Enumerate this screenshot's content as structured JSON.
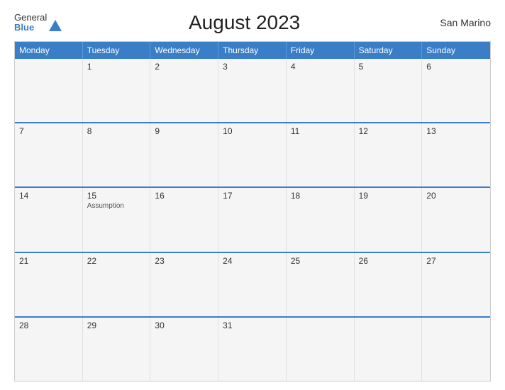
{
  "header": {
    "logo_general": "General",
    "logo_blue": "Blue",
    "title": "August 2023",
    "country": "San Marino"
  },
  "calendar": {
    "days_of_week": [
      "Monday",
      "Tuesday",
      "Wednesday",
      "Thursday",
      "Friday",
      "Saturday",
      "Sunday"
    ],
    "weeks": [
      [
        {
          "day": "",
          "event": ""
        },
        {
          "day": "1",
          "event": ""
        },
        {
          "day": "2",
          "event": ""
        },
        {
          "day": "3",
          "event": ""
        },
        {
          "day": "4",
          "event": ""
        },
        {
          "day": "5",
          "event": ""
        },
        {
          "day": "6",
          "event": ""
        }
      ],
      [
        {
          "day": "7",
          "event": ""
        },
        {
          "day": "8",
          "event": ""
        },
        {
          "day": "9",
          "event": ""
        },
        {
          "day": "10",
          "event": ""
        },
        {
          "day": "11",
          "event": ""
        },
        {
          "day": "12",
          "event": ""
        },
        {
          "day": "13",
          "event": ""
        }
      ],
      [
        {
          "day": "14",
          "event": ""
        },
        {
          "day": "15",
          "event": "Assumption"
        },
        {
          "day": "16",
          "event": ""
        },
        {
          "day": "17",
          "event": ""
        },
        {
          "day": "18",
          "event": ""
        },
        {
          "day": "19",
          "event": ""
        },
        {
          "day": "20",
          "event": ""
        }
      ],
      [
        {
          "day": "21",
          "event": ""
        },
        {
          "day": "22",
          "event": ""
        },
        {
          "day": "23",
          "event": ""
        },
        {
          "day": "24",
          "event": ""
        },
        {
          "day": "25",
          "event": ""
        },
        {
          "day": "26",
          "event": ""
        },
        {
          "day": "27",
          "event": ""
        }
      ],
      [
        {
          "day": "28",
          "event": ""
        },
        {
          "day": "29",
          "event": ""
        },
        {
          "day": "30",
          "event": ""
        },
        {
          "day": "31",
          "event": ""
        },
        {
          "day": "",
          "event": ""
        },
        {
          "day": "",
          "event": ""
        },
        {
          "day": "",
          "event": ""
        }
      ]
    ]
  }
}
